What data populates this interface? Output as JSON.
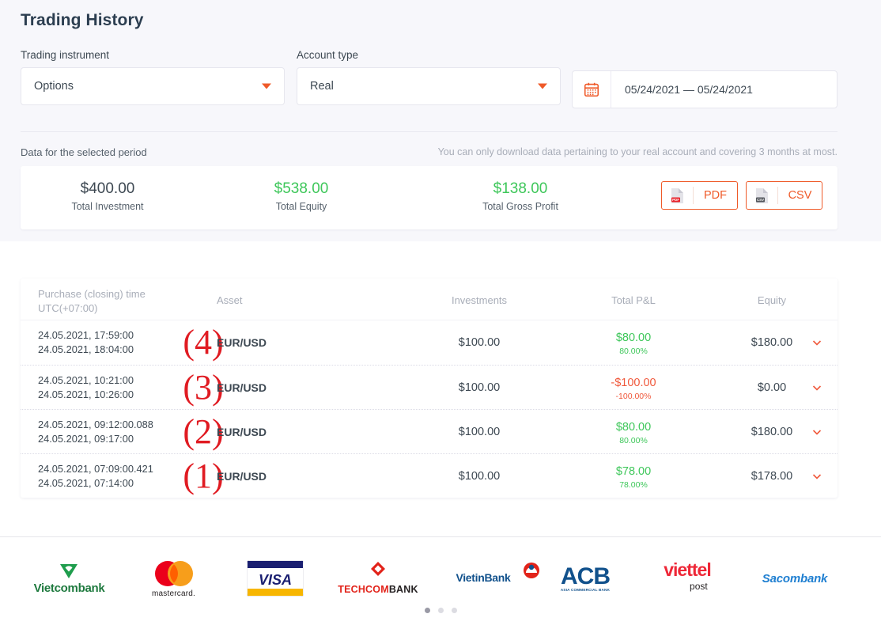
{
  "header": {
    "title": "Trading History"
  },
  "filters": {
    "instrument": {
      "label": "Trading instrument",
      "value": "Options",
      "caret_icon": "caret-down-icon"
    },
    "account": {
      "label": "Account type",
      "value": "Real",
      "caret_icon": "caret-down-icon"
    },
    "date_range": {
      "value": "05/24/2021 — 05/24/2021",
      "icon": "calendar-icon"
    }
  },
  "period": {
    "label": "Data for the selected period",
    "note": "You can only download data pertaining to your real account and covering 3 months at most."
  },
  "summary": {
    "stats": [
      {
        "value": "$400.00",
        "caption": "Total Investment",
        "tone": "neutral"
      },
      {
        "value": "$538.00",
        "caption": "Total Equity",
        "tone": "green"
      },
      {
        "value": "$138.00",
        "caption": "Total Gross Profit",
        "tone": "green"
      }
    ],
    "downloads": [
      {
        "label": "PDF",
        "icon": "pdf-file-icon",
        "badge": "PDF",
        "badge_color": "#e8212a"
      },
      {
        "label": "CSV",
        "icon": "csv-file-icon",
        "badge": "CSV",
        "badge_color": "#52565c"
      }
    ]
  },
  "table": {
    "columns": {
      "time_line1": "Purchase (closing) time",
      "time_line2": "UTC(+07:00)",
      "asset": "Asset",
      "investments": "Investments",
      "pl": "Total P&L",
      "equity": "Equity"
    },
    "rows": [
      {
        "marker": "(4)",
        "open_time": "24.05.2021, 17:59:00",
        "close_time": "24.05.2021, 18:04:00",
        "asset": "EUR/USD",
        "investment": "$100.00",
        "pl_amount": "$80.00",
        "pl_percent": "80.00%",
        "pl_tone": "pos",
        "equity": "$180.00",
        "expand_icon": "chevron-down-icon"
      },
      {
        "marker": "(3)",
        "open_time": "24.05.2021, 10:21:00",
        "close_time": "24.05.2021, 10:26:00",
        "asset": "EUR/USD",
        "investment": "$100.00",
        "pl_amount": "-$100.00",
        "pl_percent": "-100.00%",
        "pl_tone": "neg",
        "equity": "$0.00",
        "expand_icon": "chevron-down-icon"
      },
      {
        "marker": "(2)",
        "open_time": "24.05.2021, 09:12:00.088",
        "close_time": "24.05.2021, 09:17:00",
        "asset": "EUR/USD",
        "investment": "$100.00",
        "pl_amount": "$80.00",
        "pl_percent": "80.00%",
        "pl_tone": "pos",
        "equity": "$180.00",
        "expand_icon": "chevron-down-icon"
      },
      {
        "marker": "(1)",
        "open_time": "24.05.2021, 07:09:00.421",
        "close_time": "24.05.2021, 07:14:00",
        "asset": "EUR/USD",
        "investment": "$100.00",
        "pl_amount": "$78.00",
        "pl_percent": "78.00%",
        "pl_tone": "pos",
        "equity": "$178.00",
        "expand_icon": "chevron-down-icon"
      }
    ]
  },
  "footer": {
    "logos": [
      {
        "name": "Vietcombank",
        "word": "Vietcombank"
      },
      {
        "name": "mastercard",
        "word": "mastercard."
      },
      {
        "name": "VISA",
        "word": "VISA"
      },
      {
        "name": "TECHCOMBANK",
        "word1": "TECHCOM",
        "word2": "BANK"
      },
      {
        "name": "VietinBank",
        "word": "VietinBank"
      },
      {
        "name": "ACB",
        "word": "ACB",
        "sub": "ASIA COMMERCIAL BANK"
      },
      {
        "name": "viettel post",
        "word": "viettel",
        "sub": "post"
      },
      {
        "name": "Sacombank",
        "word": "Sacombank"
      }
    ],
    "carousel_dots": [
      {
        "active": true
      },
      {
        "active": false
      },
      {
        "active": false
      }
    ]
  },
  "colors": {
    "accent": "#ef5a29",
    "positive": "#3ec75a",
    "negative": "#f0593c",
    "marker": "#e01b22",
    "panel_bg": "#f7f7fb"
  }
}
